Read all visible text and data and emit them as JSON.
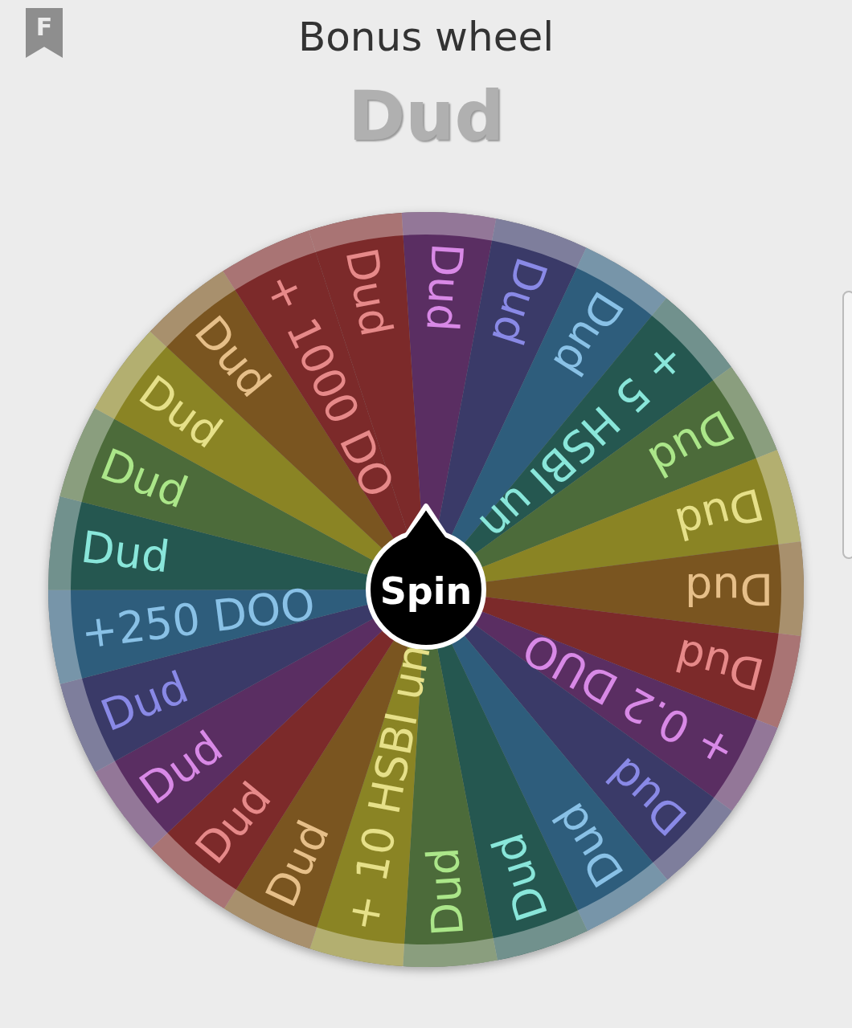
{
  "header": {
    "badge": "F",
    "title": "Bonus wheel"
  },
  "result": "Dud",
  "wheel": {
    "button": "Spin",
    "slices": [
      {
        "label": "Dud",
        "color": "#5a2e62"
      },
      {
        "label": "Dud",
        "color": "#3a3a68"
      },
      {
        "label": "Dud",
        "color": "#2e5d7c"
      },
      {
        "label": "+ 5 HSBI un",
        "color": "#255750"
      },
      {
        "label": "Dud",
        "color": "#4c6b3a"
      },
      {
        "label": "Dud",
        "color": "#8a8424"
      },
      {
        "label": "Dud",
        "color": "#7a5520"
      },
      {
        "label": "Dud",
        "color": "#7c2a2a"
      },
      {
        "label": "+ 0.2 DUO",
        "color": "#5a2e62"
      },
      {
        "label": "Dud",
        "color": "#3a3a68"
      },
      {
        "label": "Dud",
        "color": "#2e5d7c"
      },
      {
        "label": "Dud",
        "color": "#255750"
      },
      {
        "label": "Dud",
        "color": "#4c6b3a"
      },
      {
        "label": "+ 10 HSBI un",
        "color": "#8a8424"
      },
      {
        "label": "Dud",
        "color": "#7a5520"
      },
      {
        "label": "Dud",
        "color": "#7c2a2a"
      },
      {
        "label": "Dud",
        "color": "#5a2e62"
      },
      {
        "label": "Dud",
        "color": "#3a3a68"
      },
      {
        "label": "+250 DOO",
        "color": "#2e5d7c"
      },
      {
        "label": "Dud",
        "color": "#255750"
      },
      {
        "label": "Dud",
        "color": "#4c6b3a"
      },
      {
        "label": "Dud",
        "color": "#8a8424"
      },
      {
        "label": "Dud",
        "color": "#7a5520"
      },
      {
        "label": "+ 1000 DO",
        "color": "#7c2a2a"
      },
      {
        "label": "Dud",
        "color": "#7c2a2a"
      }
    ]
  }
}
